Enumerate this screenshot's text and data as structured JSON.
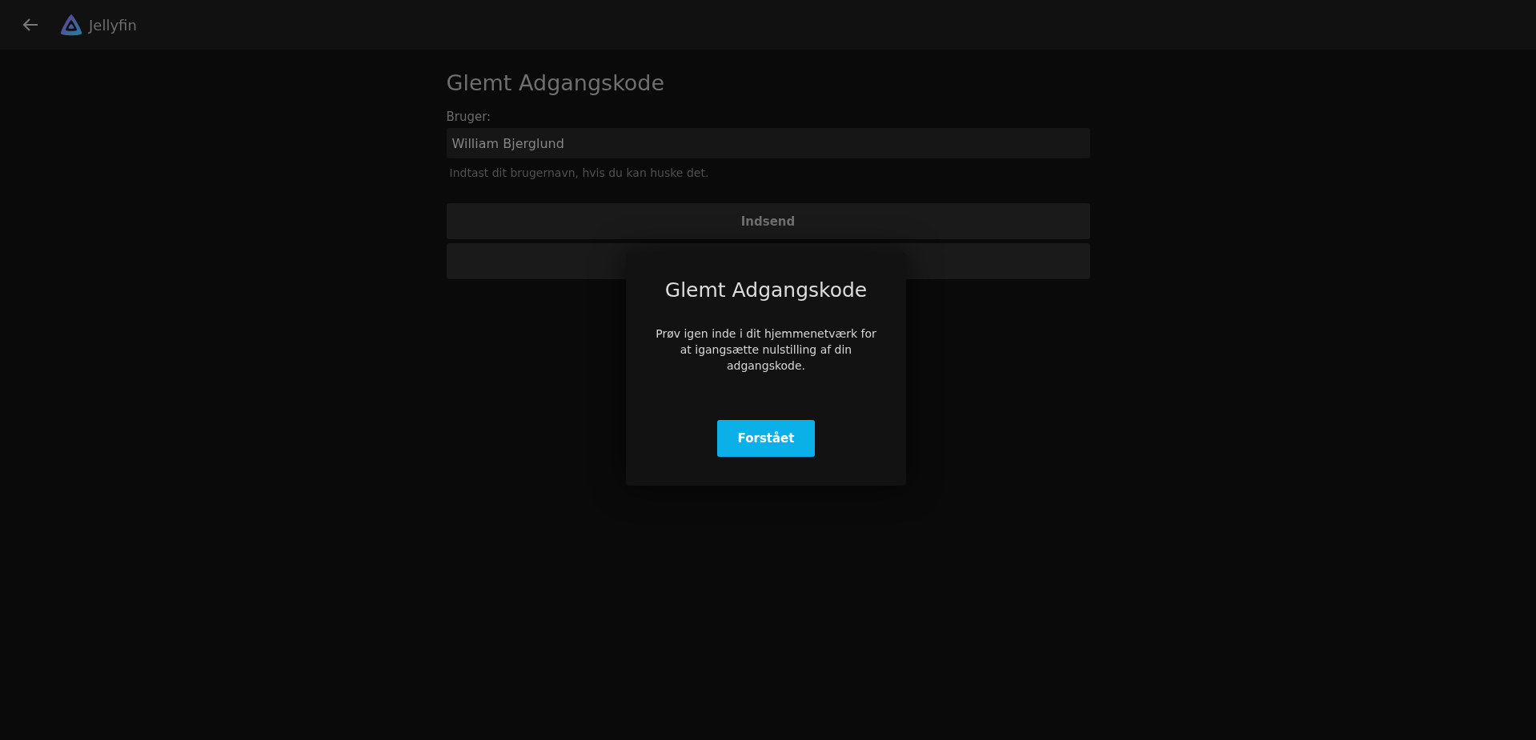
{
  "header": {
    "app_name": "Jellyfin"
  },
  "form": {
    "title": "Glemt Adgangskode",
    "field": {
      "label": "Bruger:",
      "value": "William Bjerglund",
      "hint": "Indtast dit brugernavn, hvis du kan huske det."
    },
    "buttons": [
      {
        "label": "Indsend"
      }
    ]
  },
  "dialog": {
    "title": "Glemt Adgangskode",
    "message": "Prøv igen inde i dit hjemmenetværk for at igangsætte nulstilling af din adgangskode.",
    "button": "Forstået"
  }
}
